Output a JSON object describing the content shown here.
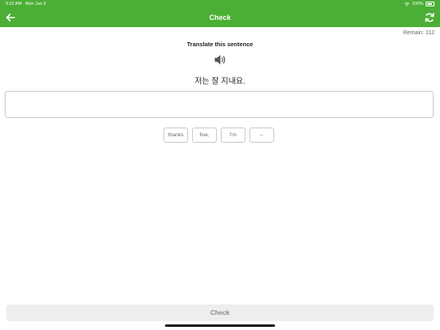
{
  "status_bar": {
    "time": "9:22 AM",
    "date": "Mon Jun 3",
    "battery": "100%"
  },
  "header": {
    "title": "Check",
    "back_icon": "arrow-left-icon",
    "refresh_icon": "refresh-icon",
    "background_color": "#4caf35"
  },
  "remain": "Remain: 112",
  "exercise": {
    "instruction": "Translate this sentence",
    "speaker_icon": "speaker-icon",
    "sentence": "저는 잘 지내요."
  },
  "answer": {
    "value": "",
    "placeholder": ""
  },
  "word_chips": [
    "thanks",
    "fine,",
    "I'm",
    "←"
  ],
  "check_button": "Check"
}
